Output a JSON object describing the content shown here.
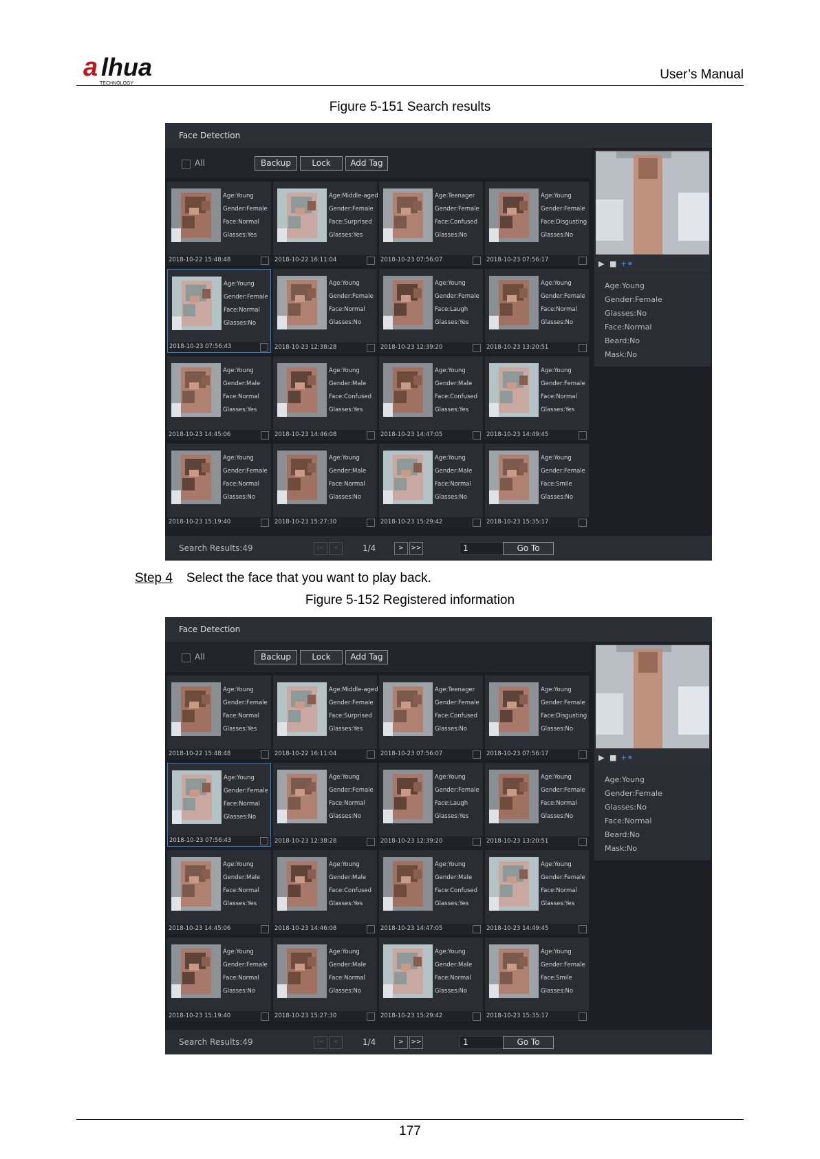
{
  "header": {
    "logo_text": "alhua",
    "logo_subtext": "TECHNOLOGY",
    "manual_title": "User’s Manual"
  },
  "figure1": {
    "caption": "Figure 5-151 Search results"
  },
  "step": {
    "label": "Step 4",
    "text": "Select the face that you want to play back."
  },
  "figure2": {
    "caption": "Figure 5-152 Registered information"
  },
  "footer": {
    "page_number": "177"
  },
  "ui": {
    "title": "Face Detection",
    "all_label": "All",
    "buttons": {
      "backup": "Backup",
      "lock": "Lock",
      "add_tag": "Add Tag"
    },
    "cards": [
      {
        "age": "Age:Young",
        "gender": "Gender:Female",
        "face": "Face:Normal",
        "glasses": "Glasses:Yes",
        "time": "2018-10-22 15:48:48"
      },
      {
        "age": "Age:Middle-aged",
        "gender": "Gender:Female",
        "face": "Face:Surprised",
        "glasses": "Glasses:Yes",
        "time": "2018-10-22 16:11:04"
      },
      {
        "age": "Age:Teenager",
        "gender": "Gender:Female",
        "face": "Face:Confused",
        "glasses": "Glasses:No",
        "time": "2018-10-23 07:56:07"
      },
      {
        "age": "Age:Young",
        "gender": "Gender:Female",
        "face": "Face:Disgusting",
        "glasses": "Glasses:No",
        "time": "2018-10-23 07:56:17"
      },
      {
        "age": "Age:Young",
        "gender": "Gender:Female",
        "face": "Face:Normal",
        "glasses": "Glasses:No",
        "time": "2018-10-23 07:56:43"
      },
      {
        "age": "Age:Young",
        "gender": "Gender:Female",
        "face": "Face:Normal",
        "glasses": "Glasses:No",
        "time": "2018-10-23 12:38:28"
      },
      {
        "age": "Age:Young",
        "gender": "Gender:Female",
        "face": "Face:Laugh",
        "glasses": "Glasses:Yes",
        "time": "2018-10-23 12:39:20"
      },
      {
        "age": "Age:Young",
        "gender": "Gender:Female",
        "face": "Face:Normal",
        "glasses": "Glasses:No",
        "time": "2018-10-23 13:20:51"
      },
      {
        "age": "Age:Young",
        "gender": "Gender:Male",
        "face": "Face:Normal",
        "glasses": "Glasses:Yes",
        "time": "2018-10-23 14:45:06"
      },
      {
        "age": "Age:Young",
        "gender": "Gender:Male",
        "face": "Face:Confused",
        "glasses": "Glasses:Yes",
        "time": "2018-10-23 14:46:08"
      },
      {
        "age": "Age:Young",
        "gender": "Gender:Male",
        "face": "Face:Confused",
        "glasses": "Glasses:Yes",
        "time": "2018-10-23 14:47:05"
      },
      {
        "age": "Age:Young",
        "gender": "Gender:Female",
        "face": "Face:Normal",
        "glasses": "Glasses:Yes",
        "time": "2018-10-23 14:49:45"
      },
      {
        "age": "Age:Young",
        "gender": "Gender:Female",
        "face": "Face:Normal",
        "glasses": "Glasses:No",
        "time": "2018-10-23 15:19:40"
      },
      {
        "age": "Age:Young",
        "gender": "Gender:Male",
        "face": "Face:Normal",
        "glasses": "Glasses:No",
        "time": "2018-10-23 15:27:30"
      },
      {
        "age": "Age:Young",
        "gender": "Gender:Male",
        "face": "Face:Normal",
        "glasses": "Glasses:No",
        "time": "2018-10-23 15:29:42"
      },
      {
        "age": "Age:Young",
        "gender": "Gender:Female",
        "face": "Face:Smile",
        "glasses": "Glasses:No",
        "time": "2018-10-23 15:35:17"
      }
    ],
    "info": [
      "Age:Young",
      "Gender:Female",
      "Glasses:No",
      "Face:Normal",
      "Beard:No",
      "Mask:No"
    ],
    "search_results": "Search Results:49",
    "pager": {
      "first": "|<",
      "prev": "<",
      "page_info": "1/4",
      "next": ">",
      "last": ">>",
      "page_input": "1",
      "goto": "Go To"
    },
    "icons": {
      "play": "play-icon",
      "stop": "stop-icon",
      "tag": "tag-icon",
      "checkbox": "checkbox-icon"
    },
    "colors": {
      "background": "#1c1e24",
      "panel": "#2a2d33",
      "selection": "#2b83c8"
    }
  }
}
